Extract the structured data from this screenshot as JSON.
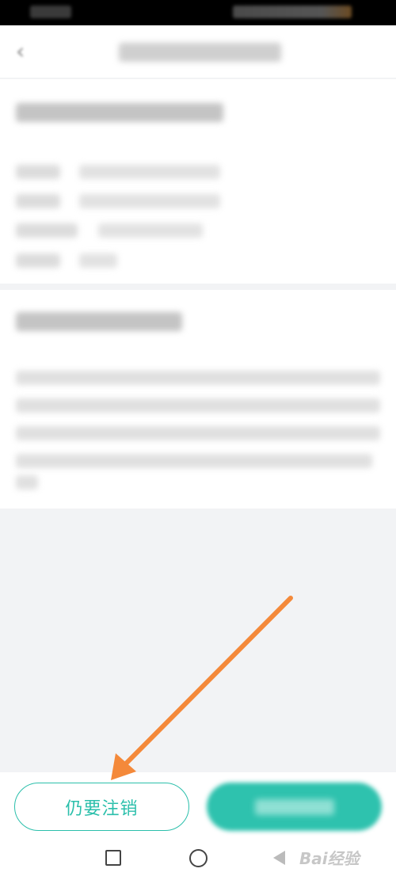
{
  "buttons": {
    "confirm_label": "仍要注销"
  },
  "watermark": {
    "text": "Bai经验"
  },
  "colors": {
    "accent": "#2bbfab",
    "annotation": "#f4893a"
  },
  "icons": {
    "back": "chevron-left-icon",
    "recent": "square-icon",
    "home": "circle-icon",
    "sys_back": "triangle-left-icon"
  }
}
